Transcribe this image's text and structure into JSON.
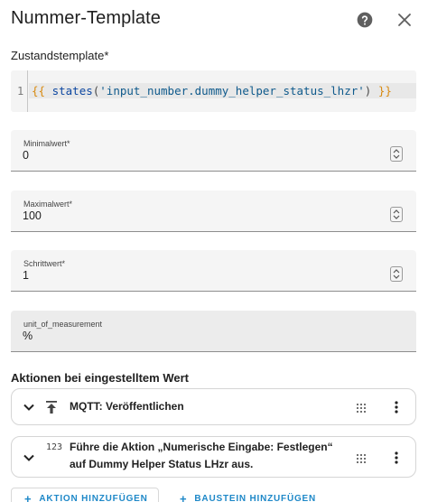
{
  "dialog": {
    "title": "Nummer-Template",
    "help_icon": "help-circle-icon",
    "close_icon": "close-icon"
  },
  "template": {
    "label": "Zustandstemplate*",
    "line_number": "1",
    "tokens": {
      "open": "{{",
      "fn": "states",
      "paren_open": "(",
      "arg": "'input_number.dummy_helper_status_lhzr'",
      "paren_close": ")",
      "close": "}}"
    }
  },
  "fields": {
    "min": {
      "label": "Minimalwert*",
      "value": "0"
    },
    "max": {
      "label": "Maximalwert*",
      "value": "100"
    },
    "step": {
      "label": "Schrittwert*",
      "value": "1"
    },
    "unit": {
      "label": "unit_of_measurement",
      "value": "%"
    }
  },
  "actions": {
    "heading": "Aktionen bei eingestelltem Wert",
    "items": [
      {
        "icon": "publish-upload-icon",
        "text": "MQTT: Veröffentlichen"
      },
      {
        "icon": "numeric-123-icon",
        "icon_text": "123",
        "text": "Führe die Aktion „Numerische Eingabe: Festlegen“ auf Dummy Helper Status LHzr aus."
      }
    ]
  },
  "buttons": {
    "add_action": "AKTION HINZUFÜGEN",
    "add_block": "BAUSTEIN HINZUFÜGEN"
  },
  "colors": {
    "accent": "#1e88c8",
    "template_brace": "#d88a10",
    "template_function": "#0d47a1"
  }
}
